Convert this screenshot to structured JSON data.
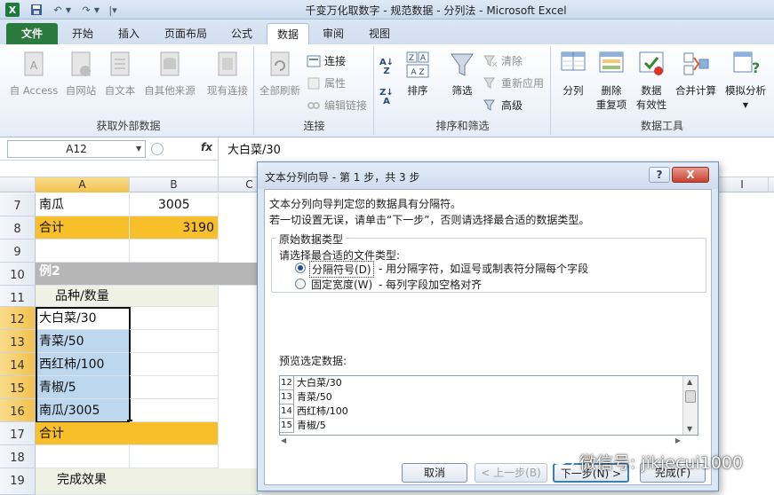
{
  "window": {
    "title": "千变万化取数字 - 规范数据 - 分列法 - Microsoft Excel"
  },
  "quick_access": {
    "logo": "X"
  },
  "tabs": [
    {
      "label": "文件",
      "active": false
    },
    {
      "label": "开始",
      "active": false
    },
    {
      "label": "插入",
      "active": false
    },
    {
      "label": "页面布局",
      "active": false
    },
    {
      "label": "公式",
      "active": false
    },
    {
      "label": "数据",
      "active": true
    },
    {
      "label": "审阅",
      "active": false
    },
    {
      "label": "视图",
      "active": false
    }
  ],
  "ribbon": {
    "external": {
      "group_label": "获取外部数据",
      "buttons": [
        "自 Access",
        "自网站",
        "自文本",
        "自其他来源",
        "现有连接"
      ]
    },
    "connections": {
      "group_label": "连接",
      "refresh_all": "全部刷新",
      "connections": "连接",
      "properties": "属性",
      "edit_links": "编辑链接"
    },
    "sort_filter": {
      "group_label": "排序和筛选",
      "sort": "排序",
      "filter": "筛选",
      "clear": "清除",
      "reapply": "重新应用",
      "advanced": "高级"
    },
    "data_tools": {
      "group_label": "数据工具",
      "text_to_columns": "分列",
      "remove_dup_line1": "删除",
      "remove_dup_line2": "重复项",
      "validation_line1": "数据",
      "validation_line2": "有效性",
      "consolidate": "合并计算",
      "whatif": "模拟分析"
    }
  },
  "formula_bar": {
    "name_box": "A12",
    "fx": "fx",
    "content": "大白菜/30"
  },
  "sheet": {
    "columns": [
      "A",
      "B",
      "C",
      "I"
    ],
    "rows": [
      {
        "num": "7",
        "a": "南瓜",
        "b": "3005"
      },
      {
        "num": "8",
        "a": "合计",
        "b": "3190"
      },
      {
        "num": "9",
        "a": "",
        "b": ""
      },
      {
        "num": "10",
        "a": "例2",
        "b": ""
      },
      {
        "num": "11",
        "a": "品种/数量",
        "b": ""
      },
      {
        "num": "12",
        "a": "大白菜/30",
        "b": ""
      },
      {
        "num": "13",
        "a": "青菜/50",
        "b": ""
      },
      {
        "num": "14",
        "a": "西红柿/100",
        "b": ""
      },
      {
        "num": "15",
        "a": "青椒/5",
        "b": ""
      },
      {
        "num": "16",
        "a": "南瓜/3005",
        "b": ""
      },
      {
        "num": "17",
        "a": "合计",
        "b": ""
      },
      {
        "num": "18",
        "a": "",
        "b": ""
      },
      {
        "num": "19",
        "a": "完成效果",
        "b": ""
      }
    ]
  },
  "dialog": {
    "title": "文本分列向导 - 第 1 步，共 3 步",
    "help": "?",
    "close": "X",
    "intro1": "文本分列向导判定您的数据具有分隔符。",
    "intro2": "若一切设置无误，请单击“下一步”，否则请选择最合适的数据类型。",
    "group_label": "原始数据类型",
    "choose_label": "请选择最合适的文件类型:",
    "option1_label": "分隔符号(D)",
    "option1_desc": "- 用分隔字符，如逗号或制表符分隔每个字段",
    "option2_label": "固定宽度(W)",
    "option2_desc": "- 每列字段加空格对齐",
    "preview_label": "预览选定数据:",
    "preview_rows": [
      {
        "num": "12",
        "text": "大白菜/30"
      },
      {
        "num": "13",
        "text": "青菜/50"
      },
      {
        "num": "14",
        "text": "西红柿/100"
      },
      {
        "num": "15",
        "text": "青椒/5"
      }
    ],
    "buttons": {
      "cancel": "取消",
      "prev": "< 上一步(B)",
      "next": "下一步(N) >",
      "finish": "完成(F)"
    }
  },
  "watermark": {
    "text": "微信号: jikjecui1000"
  }
}
